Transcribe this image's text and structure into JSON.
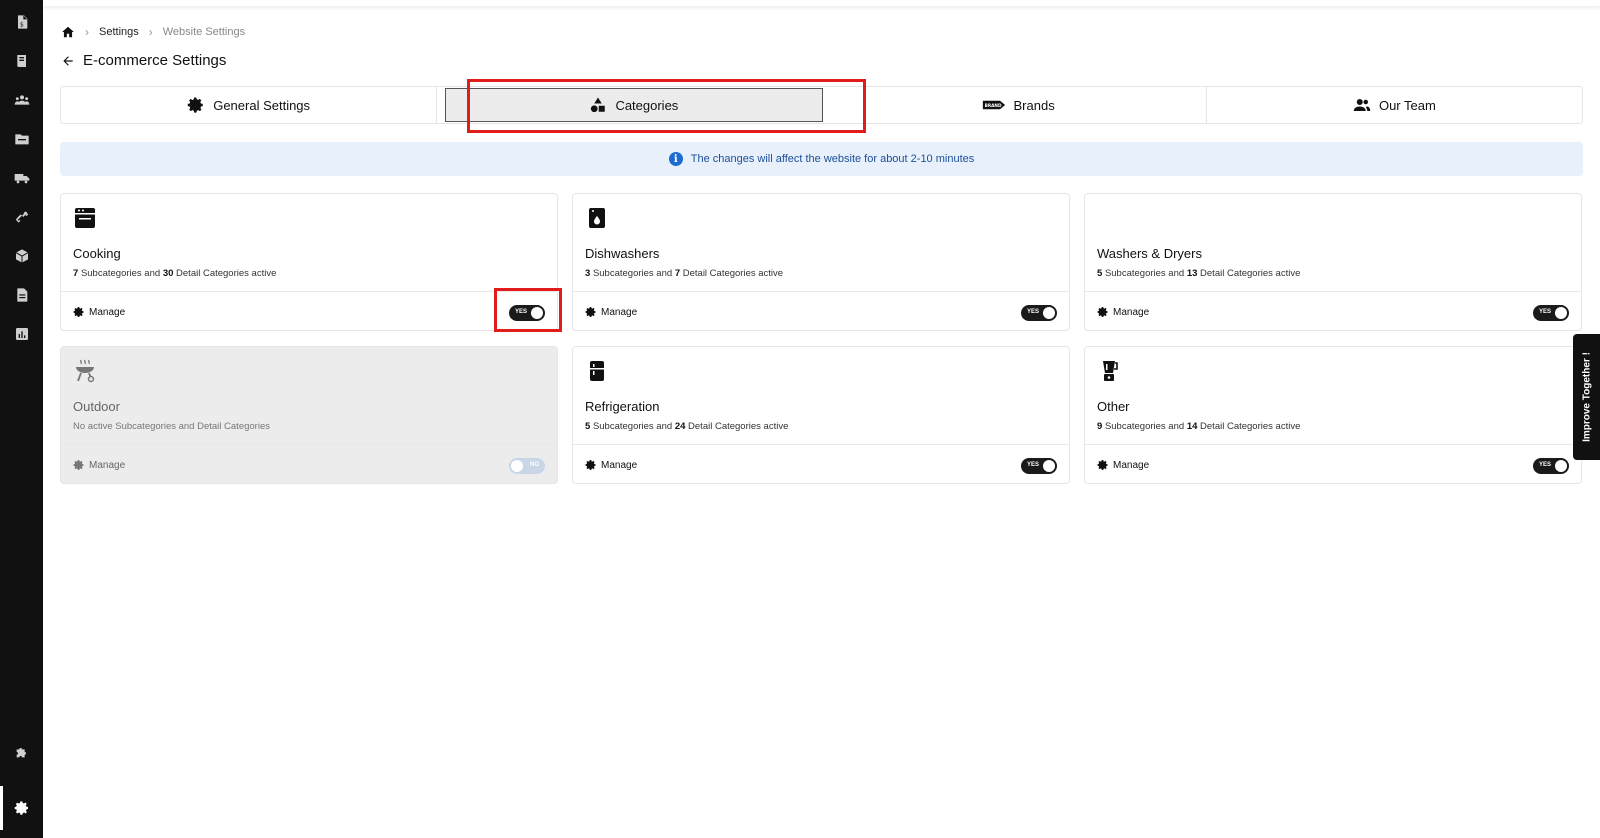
{
  "sidebar": {
    "items": [
      {
        "icon": "invoice-dollar-icon"
      },
      {
        "icon": "book-icon"
      },
      {
        "icon": "users-icon"
      },
      {
        "icon": "folder-icon"
      },
      {
        "icon": "truck-icon"
      },
      {
        "icon": "link-icon"
      },
      {
        "icon": "box-icon"
      },
      {
        "icon": "document-icon"
      },
      {
        "icon": "chart-icon"
      },
      {
        "icon": "puzzle-icon"
      },
      {
        "icon": "gear-icon"
      }
    ]
  },
  "breadcrumb": {
    "items": [
      "Settings",
      "Website Settings"
    ]
  },
  "page": {
    "title": "E-commerce Settings"
  },
  "tabs": [
    {
      "label": "General Settings",
      "icon": "gear-icon"
    },
    {
      "label": "Categories",
      "icon": "shapes-icon",
      "active": true
    },
    {
      "label": "Brands",
      "icon": "brand-tag-icon"
    },
    {
      "label": "Our Team",
      "icon": "people-icon"
    }
  ],
  "banner": {
    "text": "The changes will affect the website for about 2-10 minutes"
  },
  "cards": [
    {
      "title": "Cooking",
      "sub": "7",
      "detail": "30",
      "text_a": "Subcategories and",
      "text_b": "Detail Categories active",
      "manage": "Manage",
      "toggle": "YES",
      "enabled": true,
      "icon": "oven-icon"
    },
    {
      "title": "Dishwashers",
      "sub": "3",
      "detail": "7",
      "text_a": "Subcategories and",
      "text_b": "Detail Categories active",
      "manage": "Manage",
      "toggle": "YES",
      "enabled": true,
      "icon": "dishwasher-icon"
    },
    {
      "title": "Washers & Dryers",
      "sub": "5",
      "detail": "13",
      "text_a": "Subcategories and",
      "text_b": "Detail Categories active",
      "manage": "Manage",
      "toggle": "YES",
      "enabled": true,
      "icon": ""
    },
    {
      "title": "Outdoor",
      "desc": "No active Subcategories and Detail Categories",
      "manage": "Manage",
      "toggle": "NO",
      "enabled": false,
      "icon": "grill-icon"
    },
    {
      "title": "Refrigeration",
      "sub": "5",
      "detail": "24",
      "text_a": "Subcategories and",
      "text_b": "Detail Categories active",
      "manage": "Manage",
      "toggle": "YES",
      "enabled": true,
      "icon": "fridge-icon"
    },
    {
      "title": "Other",
      "sub": "9",
      "detail": "14",
      "text_a": "Subcategories and",
      "text_b": "Detail Categories active",
      "manage": "Manage",
      "toggle": "YES",
      "enabled": true,
      "icon": "blender-icon"
    }
  ],
  "feedback": {
    "label": "Improve Together !"
  }
}
